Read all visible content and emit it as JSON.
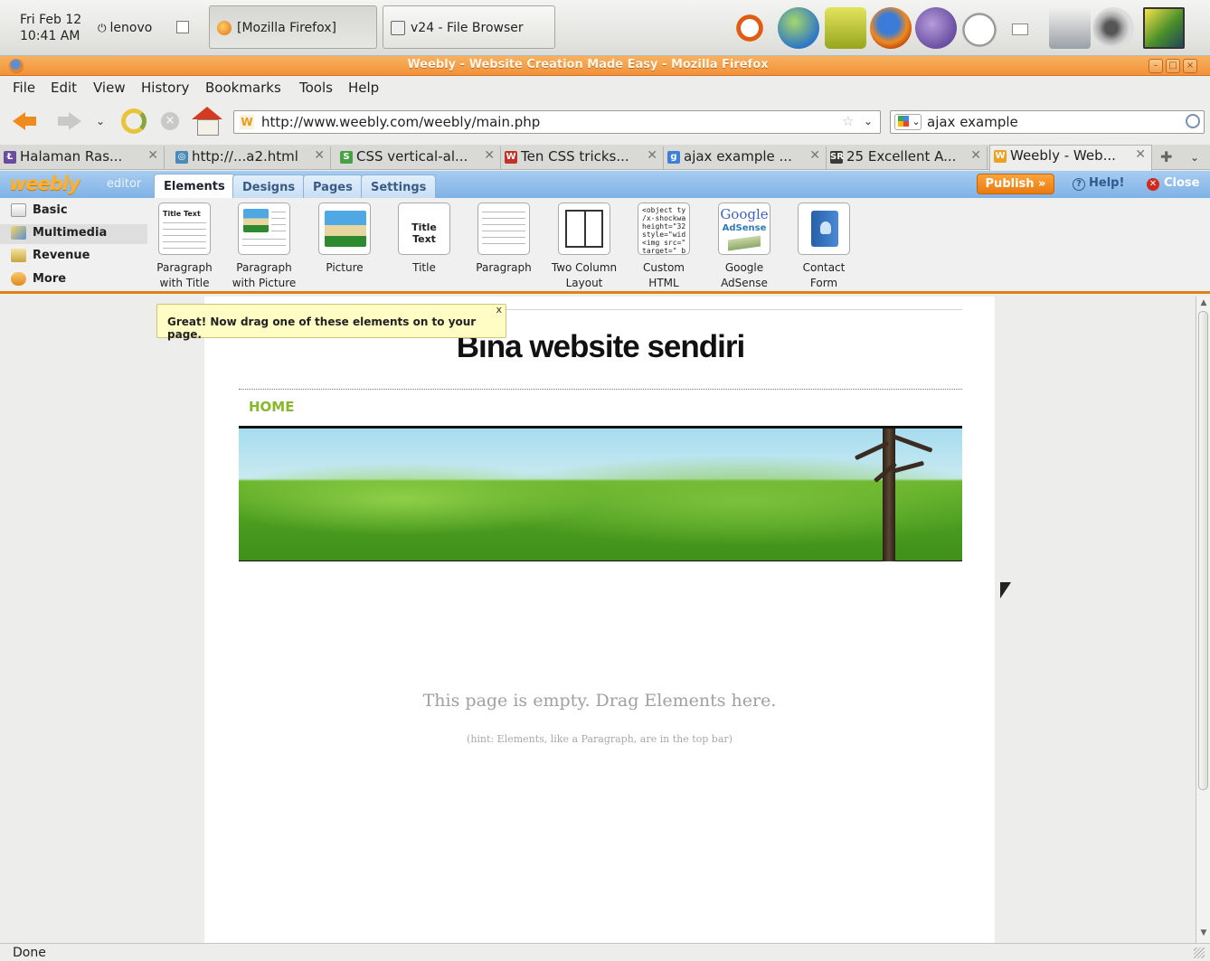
{
  "panel": {
    "clock": [
      "Fri Feb 12",
      "10:41 AM"
    ],
    "user": "lenovo",
    "user_icon": "power-icon",
    "tasks": [
      {
        "label": "[Mozilla Firefox]",
        "icon": "firefox-icon"
      },
      {
        "label": "v24 - File Browser",
        "icon": "folder-icon"
      }
    ],
    "tray_icons": [
      "ubuntu-icon",
      "globe-icon",
      "trash-icon",
      "firefox-icon",
      "pidgin-icon",
      "clock-icon",
      "mail-icon",
      "network-icon",
      "volume-icon",
      "desktop-icon"
    ]
  },
  "window": {
    "title": "Weebly - Website Creation Made Easy - Mozilla Firefox"
  },
  "menu": [
    "File",
    "Edit",
    "View",
    "History",
    "Bookmarks",
    "Tools",
    "Help"
  ],
  "toolbar": {
    "url": "http://www.weebly.com/weebly/main.php",
    "search": "ajax example",
    "history_glyph": "⌄",
    "drop_glyph": "⌄"
  },
  "tabs": [
    {
      "title": "Halaman Ras...",
      "color": "#6b4ba0"
    },
    {
      "title": "http://...a2.html",
      "color": "#4a8ab8"
    },
    {
      "title": "CSS vertical-al...",
      "color": "#4aa046"
    },
    {
      "title": "Ten CSS tricks...",
      "color": "#c2322a"
    },
    {
      "title": "ajax example ...",
      "color": "#3f7fd8"
    },
    {
      "title": "25 Excellent A...",
      "color": "#3a3a3a"
    },
    {
      "title": "Weebly - Web...",
      "color": "#f0a020"
    }
  ],
  "weebly": {
    "logo": "weebly",
    "logo_sub": "editor",
    "tabs": [
      "Elements",
      "Designs",
      "Pages",
      "Settings"
    ],
    "publish": "Publish »",
    "help": "Help!",
    "close": "Close",
    "categories": [
      "Basic",
      "Multimedia",
      "Revenue",
      "More"
    ],
    "elements": [
      {
        "label": "Paragraph\nwith Title",
        "thumb_title": "Title Text",
        "thumb_body": "It was a really s the sky. The lig through the wi"
      },
      {
        "label": "Paragraph\nwith Picture"
      },
      {
        "label": "Picture"
      },
      {
        "label": "Title",
        "thumb_title": "Title Text"
      },
      {
        "label": "Paragraph"
      },
      {
        "label": "Two Column\nLayout"
      },
      {
        "label": "Custom\nHTML",
        "thumb_code": "<object ty\n/x-shockwa\nheight=\"32\nstyle=\"wid\n<img src=\"\ntarget=\"_b"
      },
      {
        "label": "Google\nAdSense",
        "thumb_google": "Google",
        "thumb_adsense": "AdSense"
      },
      {
        "label": "Contact\nForm"
      }
    ]
  },
  "tip": {
    "text": "Great! Now drag one of these elements on to your page.",
    "close": "x"
  },
  "site": {
    "title": "Bina website sendiri",
    "nav": [
      "HOME"
    ],
    "empty_message": "This page is empty. Drag Elements here.",
    "empty_hint": "(hint: Elements, like a Paragraph, are in the top bar)"
  },
  "status": "Done"
}
